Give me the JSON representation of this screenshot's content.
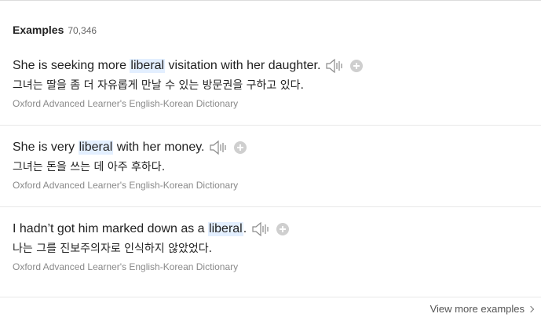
{
  "header": {
    "title": "Examples",
    "count": "70,346"
  },
  "examples": [
    {
      "before": "She is seeking more ",
      "keyword": "liberal",
      "after": " visitation with her daughter.",
      "translation": "그녀는 딸을 좀 더 자유롭게 만날 수 있는 방문권을 구하고 있다.",
      "source": "Oxford Advanced Learner's English-Korean Dictionary"
    },
    {
      "before": "She is very ",
      "keyword": "liberal",
      "after": " with her money.",
      "translation": "그녀는 돈을 쓰는 데 아주 후하다.",
      "source": "Oxford Advanced Learner's English-Korean Dictionary"
    },
    {
      "before": "I hadn’t got him marked down as a ",
      "keyword": "liberal",
      "after": ".",
      "translation": "나는 그를 진보주의자로 인식하지 않았었다.",
      "source": "Oxford Advanced Learner's English-Korean Dictionary"
    }
  ],
  "footer": {
    "view_more": "View more examples"
  },
  "colors": {
    "highlight": "#e3efff",
    "icon": "#8a8a8a",
    "add_button": "#cfcfcf"
  },
  "icons": {
    "speaker": "speaker-icon",
    "add": "plus-icon",
    "chevron": "chevron-right-icon"
  }
}
